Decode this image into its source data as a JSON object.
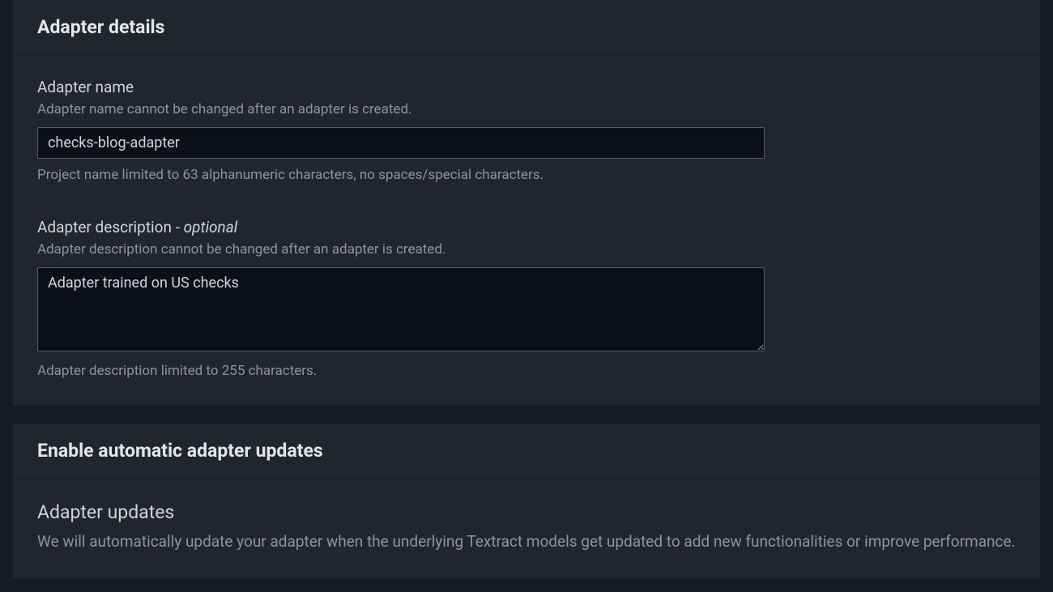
{
  "adapterDetails": {
    "heading": "Adapter details",
    "name": {
      "label": "Adapter name",
      "hintTop": "Adapter name cannot be changed after an adapter is created.",
      "value": "checks-blog-adapter",
      "hintBottom": "Project name limited to 63 alphanumeric characters, no spaces/special characters."
    },
    "description": {
      "labelPrefix": "Adapter description - ",
      "labelOptional": "optional",
      "hintTop": "Adapter description cannot be changed after an adapter is created.",
      "value": "Adapter trained on US checks",
      "hintBottom": "Adapter description limited to 255 characters."
    }
  },
  "autoUpdates": {
    "heading": "Enable automatic adapter updates",
    "subHeading": "Adapter updates",
    "body": "We will automatically update your adapter when the underlying Textract models get updated to add new functionalities or improve performance."
  }
}
